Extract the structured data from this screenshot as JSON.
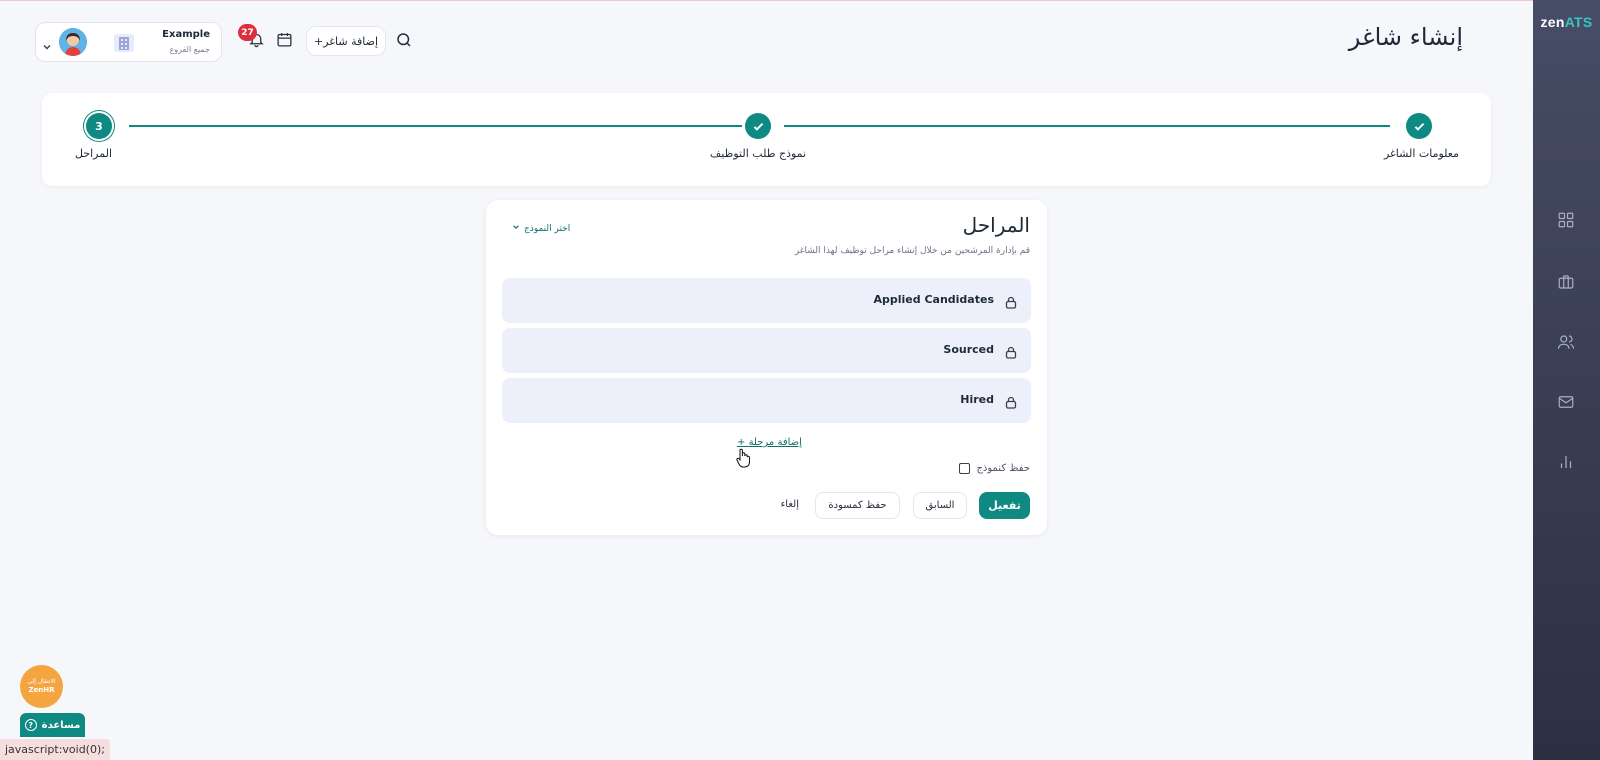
{
  "app": {
    "brand_prefix": "zen",
    "brand_suffix": "ATS"
  },
  "header": {
    "page_title": "إنشاء شاغر",
    "add_job_label": "+إضافة شاغر",
    "notification_count": "27",
    "account_name": "Example",
    "account_branch": "جميع الفروع"
  },
  "sidebar": {
    "items": [
      {
        "icon": "dashboard-grid-icon"
      },
      {
        "icon": "briefcase-icon"
      },
      {
        "icon": "users-icon"
      },
      {
        "icon": "mail-icon"
      },
      {
        "icon": "bar-chart-icon"
      }
    ]
  },
  "stepper": {
    "steps": [
      {
        "label": "معلومات الشاغر",
        "state": "completed"
      },
      {
        "label": "نموذج طلب التوظيف",
        "state": "completed"
      },
      {
        "label": "المراحل",
        "number": "3",
        "state": "current"
      }
    ],
    "accent_color": "#0f8a82"
  },
  "stages": {
    "title": "المراحل",
    "subtitle": "قم بإدارة المرشحين من خلال إنشاء مراحل توظيف لهذا الشاغر",
    "choose_template": "اختر النموذج",
    "items": [
      {
        "name": "Applied Candidates",
        "icon": "lock-icon"
      },
      {
        "name": "Sourced",
        "icon": "lock-icon"
      },
      {
        "name": "Hired",
        "icon": "lock-icon"
      }
    ],
    "add_stage": "+ إضافة مرحلة",
    "save_as_template": "حفظ كنموذج",
    "save_as_template_checked": false
  },
  "actions": {
    "activate": "تفعيل",
    "previous": "السابق",
    "save_draft": "حفظ كمسودة",
    "cancel": "إلغاء"
  },
  "widgets": {
    "zenhr_top": "الانتقال إلى",
    "zenhr_bottom": "ZenHR",
    "help": "مساعدة"
  },
  "status_bar": "javascript:void(0);"
}
